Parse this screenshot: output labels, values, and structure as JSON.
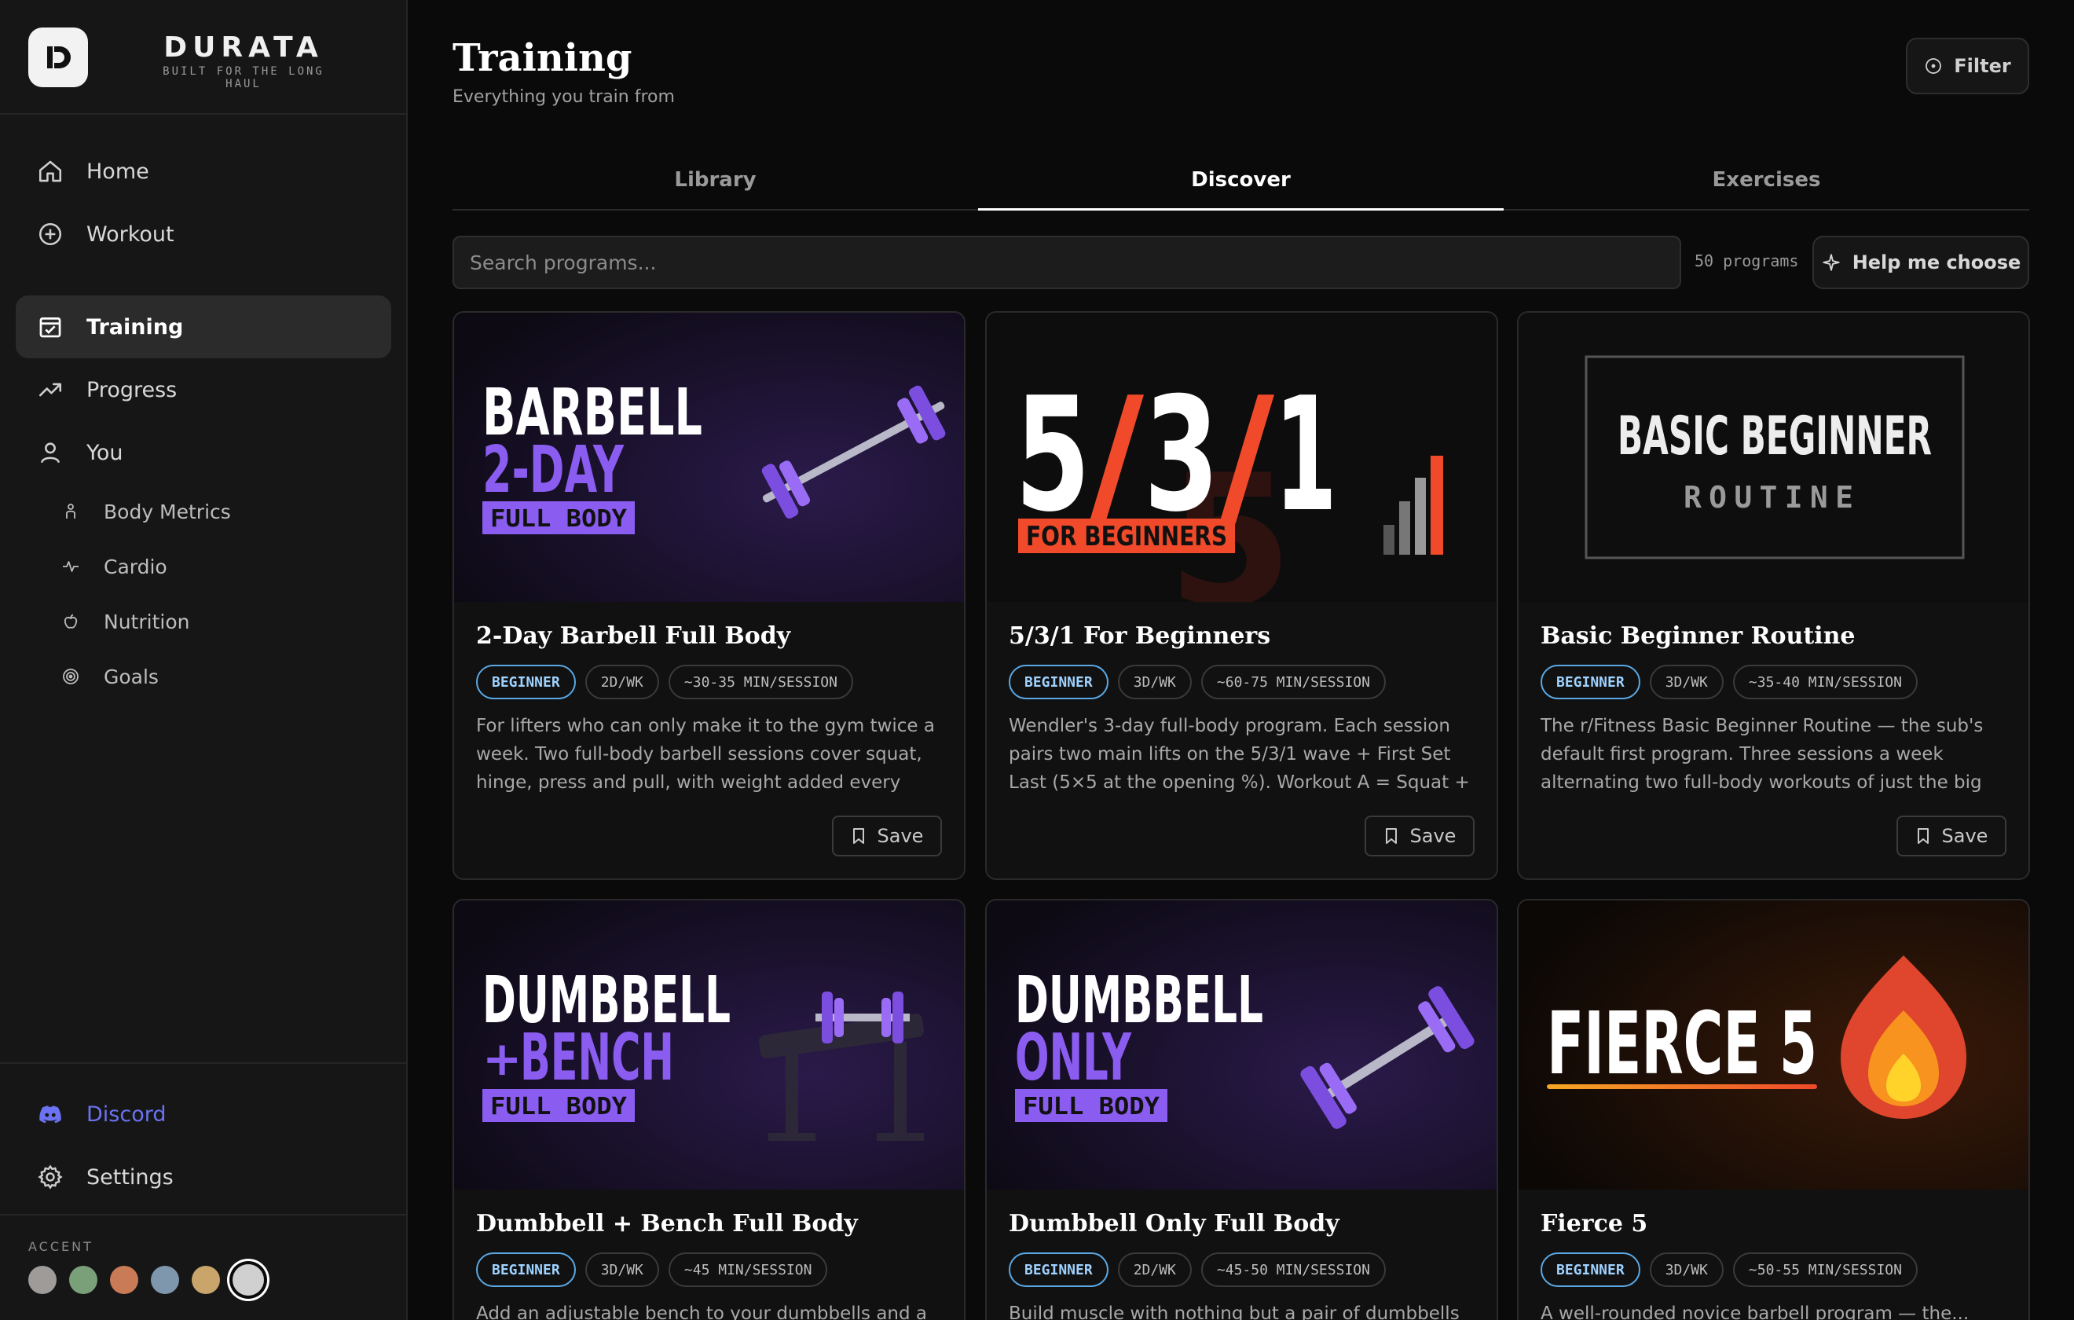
{
  "brand": {
    "name": "DURATA",
    "tagline": "BUILT FOR THE LONG HAUL"
  },
  "nav": {
    "items": [
      {
        "label": "Home",
        "icon": "home-icon"
      },
      {
        "label": "Workout",
        "icon": "plus-circle-icon"
      },
      {
        "label": "Training",
        "icon": "calendar-check-icon",
        "active": true
      },
      {
        "label": "Progress",
        "icon": "trend-up-icon"
      },
      {
        "label": "You",
        "icon": "user-icon"
      }
    ],
    "sub_items": [
      {
        "label": "Body Metrics",
        "icon": "person-icon"
      },
      {
        "label": "Cardio",
        "icon": "pulse-icon"
      },
      {
        "label": "Nutrition",
        "icon": "apple-icon"
      },
      {
        "label": "Goals",
        "icon": "target-icon"
      }
    ],
    "bottom": [
      {
        "label": "Discord",
        "icon": "discord-icon"
      },
      {
        "label": "Settings",
        "icon": "gear-icon"
      }
    ]
  },
  "accent": {
    "title": "ACCENT",
    "swatches": [
      "#9e9b98",
      "#7aa07a",
      "#c97b56",
      "#7f97ad",
      "#c9a56b",
      "#d0d0d0"
    ],
    "selected_index": 5,
    "discord_color": "#6b73f2"
  },
  "header": {
    "title": "Training",
    "subtitle": "Everything you train from",
    "filter_label": "Filter"
  },
  "tabs": [
    {
      "label": "Library"
    },
    {
      "label": "Discover",
      "active": true
    },
    {
      "label": "Exercises"
    }
  ],
  "search": {
    "placeholder": "Search programs...",
    "value": ""
  },
  "count_label": "50 programs",
  "help_label": "Help me choose",
  "cards": [
    {
      "title": "2-Day Barbell Full Body",
      "tags": [
        "BEGINNER",
        "2D/WK",
        "~30-35 MIN/SESSION"
      ],
      "description": "For lifters who can only make it to the gym twice a week. Two full-body barbell sessions cover squat, hinge, press and pull, with weight added every session you...",
      "save_label": "Save",
      "art": {
        "line1": "BARBELL",
        "line2": "2-DAY",
        "line3": "FULL BODY"
      }
    },
    {
      "title": "5/3/1 For Beginners",
      "tags": [
        "BEGINNER",
        "3D/WK",
        "~60-75 MIN/SESSION"
      ],
      "description": "Wendler's 3-day full-body program. Each session pairs two main lifts on the 5/3/1 wave + First Set Last (5×5 at the opening %). Workout A = Squat + Bench; Workout...",
      "save_label": "Save",
      "art": {
        "n1": "5",
        "s1": "/",
        "n2": "3",
        "s2": "/",
        "n3": "1",
        "banner": "FOR BEGINNERS"
      }
    },
    {
      "title": "Basic Beginner Routine",
      "tags": [
        "BEGINNER",
        "3D/WK",
        "~35-40 MIN/SESSION"
      ],
      "description": "The r/Fitness Basic Beginner Routine — the sub's default first program. Three sessions a week alternating two full-body workouts of just the big barbell lifts at...",
      "save_label": "Save",
      "art": {
        "line1": "BASIC BEGINNER",
        "line2": "ROUTINE"
      }
    },
    {
      "title": "Dumbbell + Bench Full Body",
      "tags": [
        "BEGINNER",
        "3D/WK",
        "~45 MIN/SESSION"
      ],
      "description": "Add an adjustable bench to your dumbbells and a third...",
      "save_label": "Save",
      "art": {
        "line1": "DUMBBELL",
        "plus": "+",
        "line2": "BENCH",
        "line3": "FULL BODY"
      }
    },
    {
      "title": "Dumbbell Only Full Body",
      "tags": [
        "BEGINNER",
        "2D/WK",
        "~45-50 MIN/SESSION"
      ],
      "description": "Build muscle with nothing but a pair of dumbbells — no...",
      "save_label": "Save",
      "art": {
        "line1": "DUMBBELL",
        "line2": "ONLY",
        "line3": "FULL BODY"
      }
    },
    {
      "title": "Fierce 5",
      "tags": [
        "BEGINNER",
        "3D/WK",
        "~50-55 MIN/SESSION"
      ],
      "description": "A well-rounded novice barbell program — the...",
      "save_label": "Save",
      "art": {
        "line1": "FIERCE 5"
      }
    }
  ],
  "colors": {
    "purple": "#7c4ee0",
    "purple_light": "#9a6cf5",
    "red": "#f04a2a",
    "level_chip": "#5aa9e6"
  }
}
